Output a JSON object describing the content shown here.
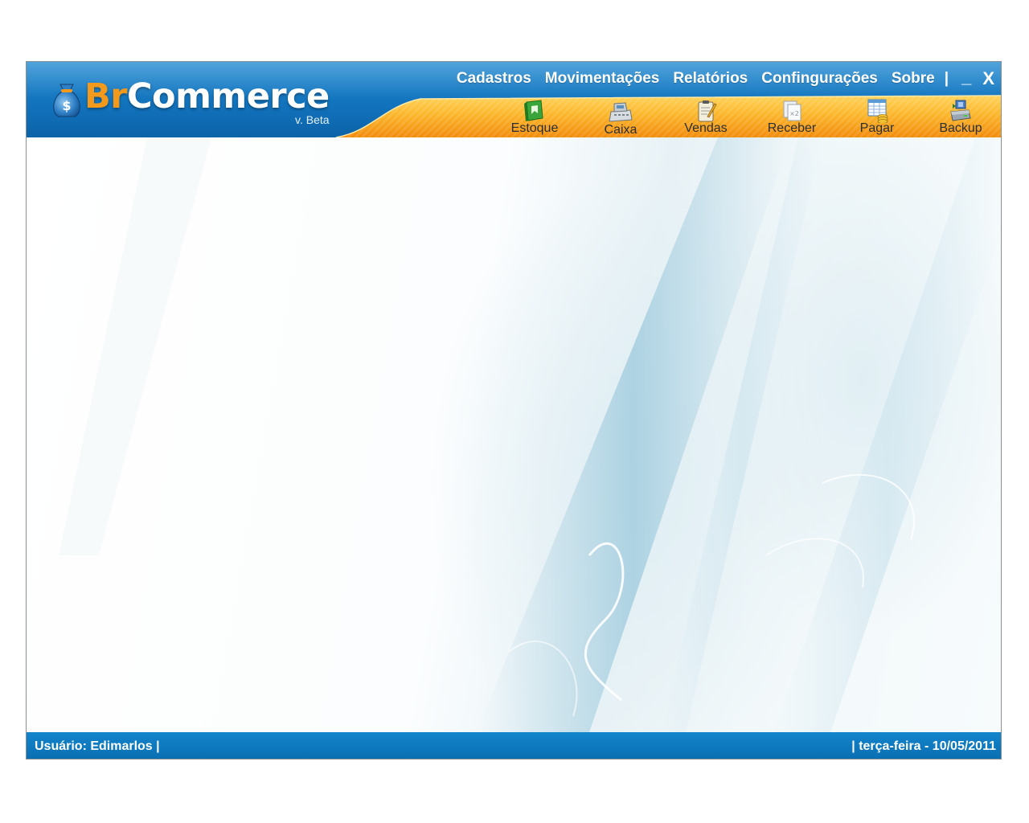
{
  "app": {
    "name_part1": "Br",
    "name_part2": "Commerce",
    "version": "v. Beta"
  },
  "menu": {
    "items": [
      "Cadastros",
      "Movimentações",
      "Relatórios",
      "Confingurações",
      "Sobre"
    ],
    "separator": "|",
    "minimize_label": "_",
    "close_label": "X"
  },
  "toolbar": {
    "items": [
      {
        "label": "Estoque",
        "icon": "book-icon"
      },
      {
        "label": "Caixa",
        "icon": "cash-register-icon"
      },
      {
        "label": "Vendas",
        "icon": "clipboard-pencil-icon"
      },
      {
        "label": "Receber",
        "icon": "documents-icon"
      },
      {
        "label": "Pagar",
        "icon": "spreadsheet-coins-icon"
      },
      {
        "label": "Backup",
        "icon": "backup-drive-icon"
      }
    ]
  },
  "statusbar": {
    "user": "Usuário: Edimarlos |",
    "date": "| terça-feira - 10/05/2011"
  },
  "colors": {
    "header_blue": "#1273bd",
    "accent_orange": "#f7a51e",
    "statusbar_blue": "#0a7ac2"
  }
}
